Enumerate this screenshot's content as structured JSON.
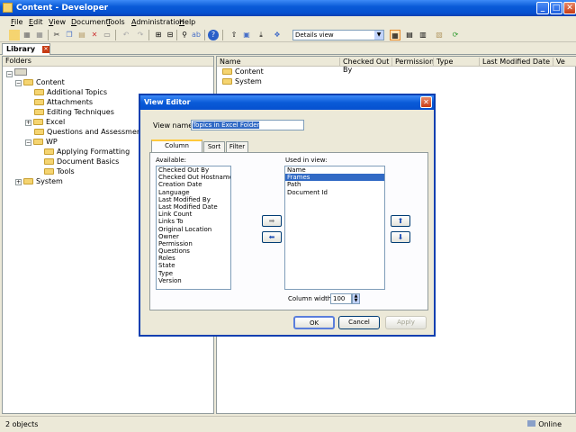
{
  "window": {
    "title": "Content - Developer",
    "min": "_",
    "max": "□",
    "close": "✕"
  },
  "menu": [
    {
      "u": "F",
      "rest": "ile"
    },
    {
      "u": "E",
      "rest": "dit"
    },
    {
      "u": "V",
      "rest": "iew"
    },
    {
      "u": "D",
      "rest": "ocument"
    },
    {
      "u": "T",
      "rest": "ools"
    },
    {
      "u": "A",
      "rest": "dministration"
    },
    {
      "u": "H",
      "rest": "elp"
    }
  ],
  "toolbar": {
    "view_select": "Details view"
  },
  "tabs": {
    "library": "Library"
  },
  "folders": {
    "header": "Folders",
    "root_expander": "⊟",
    "items": [
      {
        "label": "Content",
        "exp": "−"
      },
      {
        "label": "Additional Topics",
        "exp": ""
      },
      {
        "label": "Attachments",
        "exp": ""
      },
      {
        "label": "Editing Techniques",
        "exp": ""
      },
      {
        "label": "Excel",
        "exp": "+"
      },
      {
        "label": "Questions and Assessments",
        "exp": ""
      },
      {
        "label": "WP",
        "exp": "−"
      },
      {
        "label": "Applying Formatting",
        "exp": ""
      },
      {
        "label": "Document Basics",
        "exp": ""
      },
      {
        "label": "Tools",
        "exp": ""
      },
      {
        "label": "System",
        "exp": "+"
      }
    ]
  },
  "list": {
    "columns": [
      "Name",
      "Checked Out By",
      "Permission",
      "Type",
      "Last Modified Date",
      "Ve"
    ],
    "rows": [
      "Content",
      "System"
    ]
  },
  "status": {
    "count": "2 objects",
    "online": "Online"
  },
  "dialog": {
    "title": "View Editor",
    "close": "✕",
    "view_name_label": "View name:",
    "view_name_value": "Topics in Excel Folder",
    "tabs": [
      "Column Selection",
      "Sort",
      "Filter"
    ],
    "available_label": "Available:",
    "available": [
      "Checked Out By",
      "Checked Out Hostname",
      "Creation Date",
      "Language",
      "Last Modified By",
      "Last Modified Date",
      "Link Count",
      "Links To",
      "Original Location",
      "Owner",
      "Permission",
      "Questions",
      "Roles",
      "State",
      "Type",
      "Version"
    ],
    "used_label": "Used in view:",
    "used": [
      "Name",
      "Frames",
      "Path",
      "Document Id"
    ],
    "used_selected_index": 1,
    "column_width_label": "Column width:",
    "column_width": "100",
    "ok": "OK",
    "cancel": "Cancel",
    "apply": "Apply"
  },
  "colors": {
    "title_blue": "#0a5bd8",
    "selection": "#316ac5",
    "folder": "#f5d470"
  }
}
